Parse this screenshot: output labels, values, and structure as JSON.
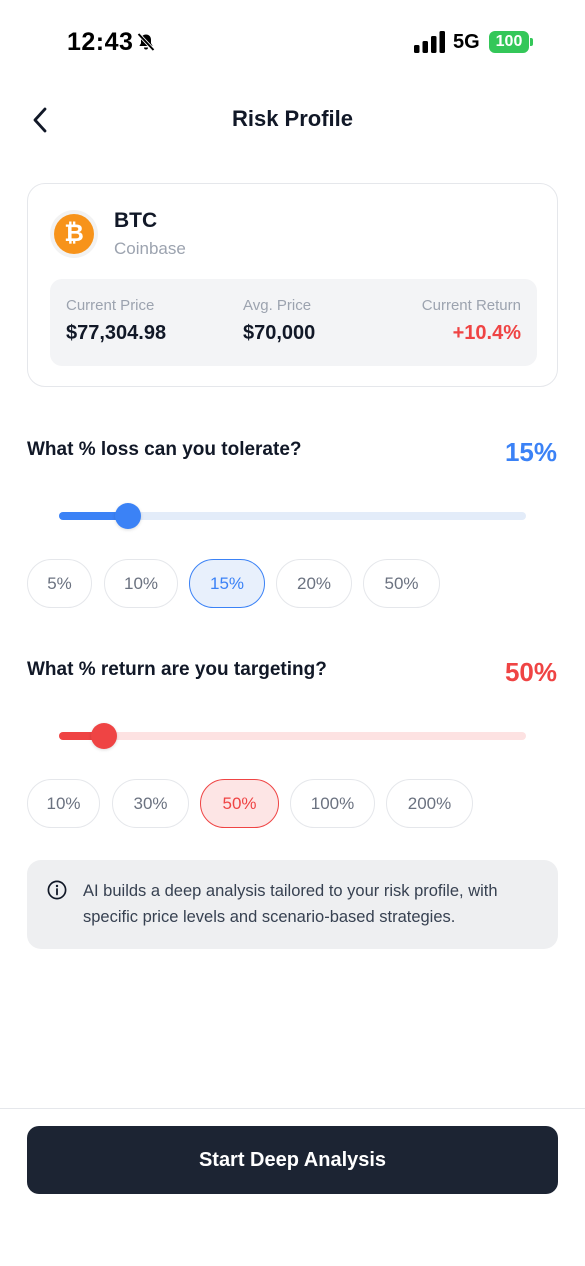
{
  "status_bar": {
    "time": "12:43",
    "network": "5G",
    "battery": "100"
  },
  "header": {
    "title": "Risk Profile"
  },
  "asset": {
    "symbol": "BTC",
    "exchange": "Coinbase",
    "logo_glyph": "₿",
    "logo_color": "#f7931a",
    "current_price_label": "Current Price",
    "current_price": "$77,304.98",
    "avg_price_label": "Avg. Price",
    "avg_price": "$70,000",
    "current_return_label": "Current Return",
    "current_return": "+10.4%"
  },
  "loss_question": {
    "label": "What % loss can you tolerate?",
    "value": "15%",
    "slider_fraction": 0.147,
    "accent": "#3b82f6",
    "options": [
      "5%",
      "10%",
      "15%",
      "20%",
      "50%"
    ],
    "selected_index": 2
  },
  "return_question": {
    "label": "What % return are you targeting?",
    "value": "50%",
    "slider_fraction": 0.097,
    "accent": "#ef4444",
    "options": [
      "10%",
      "30%",
      "50%",
      "100%",
      "200%"
    ],
    "selected_index": 2
  },
  "info": {
    "icon": "info-icon",
    "text": "AI builds a deep analysis tailored to your risk profile, with specific price levels and scenario-based strategies."
  },
  "cta": {
    "label": "Start Deep Analysis"
  }
}
